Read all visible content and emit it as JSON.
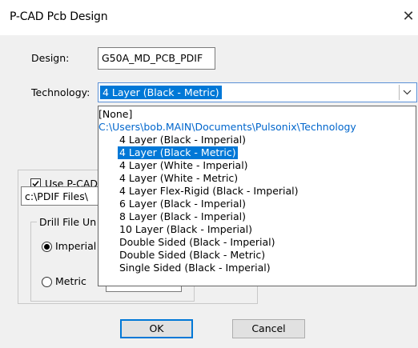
{
  "window": {
    "title": "P-CAD Pcb Design",
    "close_glyph": "✕"
  },
  "design": {
    "label": "Design:",
    "value": "G50A_MD_PCB_PDIF"
  },
  "technology": {
    "label": "Technology:",
    "selected": "4 Layer (Black - Metric)",
    "options": [
      "[None]",
      "C:\\Users\\bob.MAIN\\Documents\\Pulsonix\\Technology",
      "4 Layer (Black - Imperial)",
      "4 Layer (Black - Metric)",
      "4 Layer (White - Imperial)",
      "4 Layer (White - Metric)",
      "4 Layer Flex-Rigid (Black - Imperial)",
      "6 Layer (Black - Imperial)",
      "8 Layer (Black - Imperial)",
      "10 Layer (Black - Imperial)",
      "Double Sided (Black - Imperial)",
      "Double Sided (Black - Metric)",
      "Single Sided (Black - Imperial)"
    ]
  },
  "use_pcad": {
    "label": "Use P-CAD",
    "checked": true,
    "path_value": "c:\\PDIF Files\\"
  },
  "drill_units": {
    "label": "Drill File Un",
    "imperial_label": "Imperial",
    "metric_label": "Metric",
    "selected": "Imperial"
  },
  "buttons": {
    "ok": "OK",
    "cancel": "Cancel"
  },
  "colors": {
    "selection": "#0078d7",
    "path_text": "#0066cc",
    "dialog_bg": "#f0f0f0"
  }
}
